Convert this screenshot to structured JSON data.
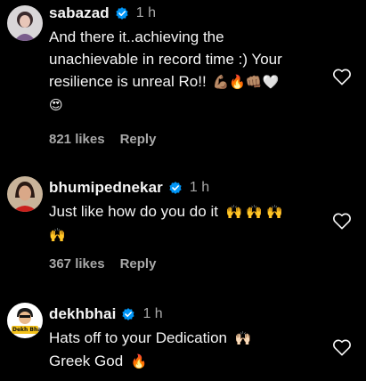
{
  "comments": [
    {
      "username": "sabazad",
      "time": "1 h",
      "lines": [
        "And there it..achieving the",
        "unachievable in record time :) Your",
        "resilience is unreal Ro!!"
      ],
      "line3_emojis": "💪🏽🔥👊🏽🤍",
      "line4_emojis": "😍",
      "likes": "821 likes",
      "reply": "Reply"
    },
    {
      "username": "bhumipednekar",
      "time": "1 h",
      "lines": [
        "Just like how do you do it"
      ],
      "line1_emojis": "🙌🙌🙌",
      "line2_emojis": "🙌",
      "likes": "367 likes",
      "reply": "Reply"
    },
    {
      "username": "dekhbhai",
      "time": "1 h",
      "avatar_text": "Dekh Bhai",
      "lines": [
        "Hats off to your Dedication",
        "Greek God"
      ],
      "line1_emojis": "🙌🏻",
      "line2_emojis": "🔥"
    }
  ],
  "icons": {
    "verified": "verified-badge-icon",
    "like": "heart-outline-icon"
  },
  "colors": {
    "background": "#000000",
    "text": "#f5f5f5",
    "muted": "#a8a8a8",
    "verified": "#0095f6"
  }
}
